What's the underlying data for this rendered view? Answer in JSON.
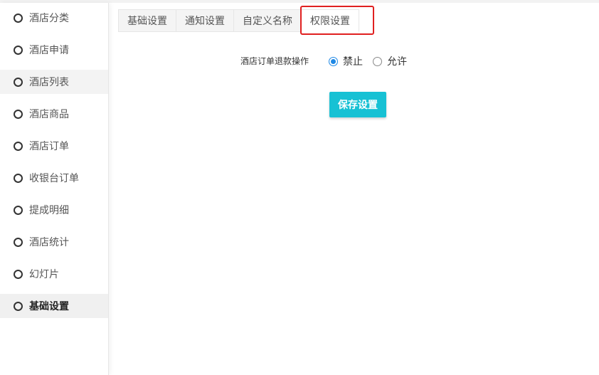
{
  "sidebar": {
    "items": [
      {
        "label": "酒店分类",
        "icon": "circle-icon"
      },
      {
        "label": "酒店申请",
        "icon": "circle-icon"
      },
      {
        "label": "酒店列表",
        "icon": "circle-icon"
      },
      {
        "label": "酒店商品",
        "icon": "circle-icon"
      },
      {
        "label": "酒店订单",
        "icon": "circle-icon"
      },
      {
        "label": "收银台订单",
        "icon": "circle-icon"
      },
      {
        "label": "提成明细",
        "icon": "circle-icon"
      },
      {
        "label": "酒店统计",
        "icon": "circle-icon"
      },
      {
        "label": "幻灯片",
        "icon": "circle-icon"
      },
      {
        "label": "基础设置",
        "icon": "circle-icon"
      }
    ],
    "active_item": "基础设置",
    "hover_item": "酒店列表"
  },
  "tabs": [
    {
      "label": "基础设置"
    },
    {
      "label": "通知设置"
    },
    {
      "label": "自定义名称"
    },
    {
      "label": "权限设置"
    }
  ],
  "active_tab": "权限设置",
  "form": {
    "refund_label": "酒店订单退款操作",
    "options": [
      {
        "label": "禁止",
        "checked": true
      },
      {
        "label": "允许",
        "checked": false
      }
    ]
  },
  "save_button": {
    "label": "保存设置"
  },
  "colors": {
    "accent_button": "#17c1d4",
    "radio_checked": "#1e88e5",
    "highlight_border": "#e02020"
  }
}
